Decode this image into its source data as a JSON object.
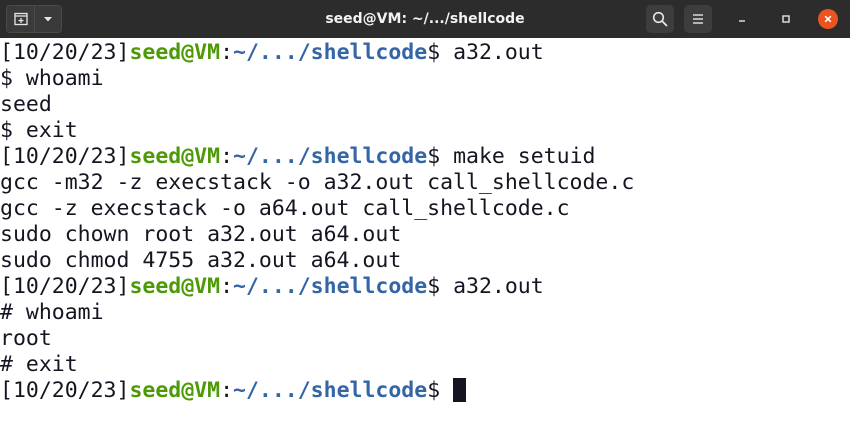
{
  "window": {
    "title": "seed@VM: ~/.../shellcode",
    "icons": {
      "new_tab": "new-tab-icon",
      "dropdown": "chevron-down-icon",
      "search": "search-icon",
      "menu": "hamburger-menu-icon",
      "minimize": "minimize-icon",
      "maximize": "maximize-icon",
      "close": "close-icon"
    },
    "colors": {
      "titlebar": "#2c2c2c",
      "close": "#e95420",
      "prompt_user": "#4e9a06",
      "prompt_path": "#3465a4",
      "text": "#171421"
    }
  },
  "terminal": {
    "prompt": {
      "date": "[10/20/23]",
      "user_host": "seed@VM",
      "colon": ":",
      "path": "~/.../shellcode",
      "symbol": "$ "
    },
    "lines": [
      {
        "type": "prompt",
        "command": "a32.out"
      },
      {
        "type": "output",
        "text": "$ whoami"
      },
      {
        "type": "output",
        "text": "seed"
      },
      {
        "type": "output",
        "text": "$ exit"
      },
      {
        "type": "prompt",
        "command": "make setuid"
      },
      {
        "type": "output",
        "text": "gcc -m32 -z execstack -o a32.out call_shellcode.c"
      },
      {
        "type": "output",
        "text": "gcc -z execstack -o a64.out call_shellcode.c"
      },
      {
        "type": "output",
        "text": "sudo chown root a32.out a64.out"
      },
      {
        "type": "output",
        "text": "sudo chmod 4755 a32.out a64.out"
      },
      {
        "type": "prompt",
        "command": "a32.out"
      },
      {
        "type": "output",
        "text": "# whoami"
      },
      {
        "type": "output",
        "text": "root"
      },
      {
        "type": "output",
        "text": "# exit"
      },
      {
        "type": "prompt",
        "command": "",
        "cursor": true
      }
    ]
  }
}
